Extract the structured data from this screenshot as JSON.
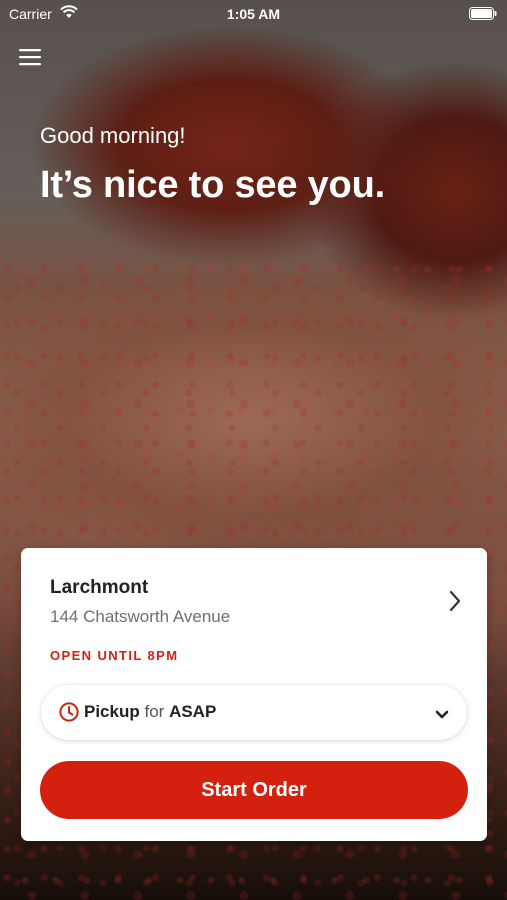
{
  "status_bar": {
    "carrier": "Carrier",
    "time": "1:05 AM",
    "icons": [
      "wifi-icon",
      "battery-icon"
    ]
  },
  "header": {
    "menu_icon": "hamburger-menu-icon",
    "greeting": "Good morning!",
    "headline": "It’s nice to see you."
  },
  "location_card": {
    "name": "Larchmont",
    "address": "144 Chatsworth Avenue",
    "hours": "OPEN UNTIL 8PM",
    "chevron_icon": "chevron-right-icon",
    "order_mode": {
      "icon": "clock-icon",
      "mode": "Pickup",
      "for_word": "for",
      "when": "ASAP",
      "caret_icon": "chevron-down-icon"
    },
    "start_button_label": "Start Order"
  },
  "colors": {
    "accent": "#d4210f",
    "card_background": "#ffffff",
    "text_primary": "#222222",
    "text_secondary": "#707070"
  }
}
